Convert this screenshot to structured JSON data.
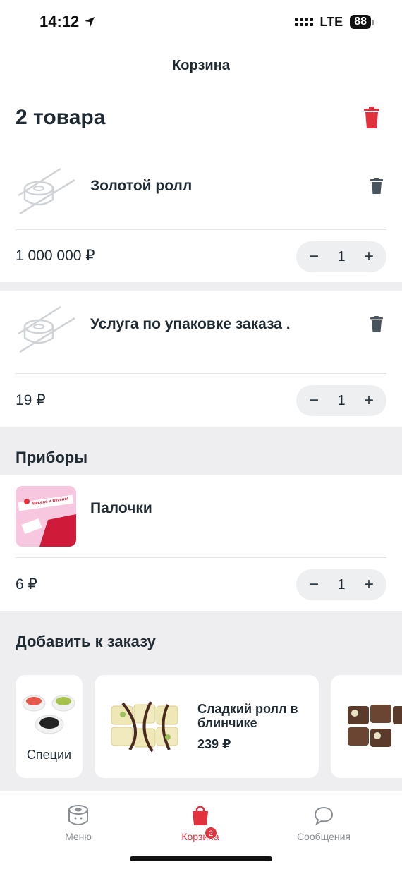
{
  "status": {
    "time": "14:12",
    "network": "LTE",
    "battery": "88"
  },
  "header": {
    "title": "Корзина"
  },
  "cart": {
    "count_label": "2 товара",
    "items": [
      {
        "name": "Золотой ролл",
        "price": "1 000 000 ₽",
        "qty": "1",
        "thumb": "roll-placeholder-icon"
      },
      {
        "name": "Услуга по упаковке заказа .",
        "price": "19 ₽",
        "qty": "1",
        "thumb": "roll-placeholder-icon"
      }
    ]
  },
  "cutlery": {
    "title": "Приборы",
    "item": {
      "name": "Палочки",
      "price": "6 ₽",
      "qty": "1",
      "thumb_caption": "Весело и вкусно!"
    }
  },
  "addons": {
    "title": "Добавить к заказу",
    "cards": [
      {
        "name": "Специи"
      },
      {
        "name": "Сладкий ролл в блинчике",
        "price": "239 ₽"
      }
    ]
  },
  "stepper": {
    "minus": "−",
    "plus": "+"
  },
  "tabbar": {
    "tabs": [
      {
        "label": "Меню",
        "icon": "sushi-icon"
      },
      {
        "label": "Корзина",
        "icon": "bag-icon",
        "badge": "2",
        "active": true
      },
      {
        "label": "Сообщения",
        "icon": "chat-bubble-icon"
      }
    ]
  },
  "colors": {
    "accent": "#e0313d",
    "text": "#1f2a33",
    "muted": "#8a8f95",
    "band": "#eeeef0"
  }
}
